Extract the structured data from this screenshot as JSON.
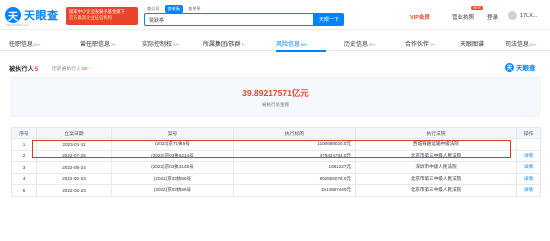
{
  "header": {
    "logo_mark": "天",
    "logo_text": "天眼查",
    "logo_sub": "TianYanCha.com",
    "promo_line1": "国家中小企业发展子基金旗下",
    "promo_line2": "官方备案企业征信机构",
    "search_tabs": [
      "查公司",
      "查老板",
      "查关系"
    ],
    "search_value": "贾跃亭",
    "search_button": "天眼一下",
    "vip": "VIP会员",
    "nav_items": [
      "营业执照",
      "登录"
    ],
    "new_badge": "NEW",
    "username": "17LX..."
  },
  "tabs": [
    {
      "label": "任职信息",
      "count": "99+"
    },
    {
      "label": "曾任职信息",
      "count": "26"
    },
    {
      "label": "实际控制权",
      "count": "99+"
    },
    {
      "label": "所属集团/族群",
      "count": "2"
    },
    {
      "label": "风险信息",
      "count": "99+"
    },
    {
      "label": "历史信息",
      "count": "99+"
    },
    {
      "label": "合作伙伴",
      "count": "19"
    },
    {
      "label": "天眼图谱",
      "count": ""
    },
    {
      "label": "司法信息",
      "count": "99+"
    }
  ],
  "section": {
    "title": "被执行人",
    "count": "5",
    "history_label": "历史被执行人",
    "history_count": "60",
    "logo_text": "天眼查"
  },
  "summary": {
    "amount": "39.89217571亿元",
    "label": "被执行总金额"
  },
  "table": {
    "headers": [
      "序号",
      "立案日期",
      "案号",
      "执行标的",
      "执行法院",
      "操作"
    ],
    "rows": [
      [
        "1",
        "2023-01-11",
        "(2023)京71执6号",
        "1100689020.0元",
        "西城铁路运输中级法院",
        ""
      ],
      [
        "2",
        "2022-07-25",
        "(2022)京03执6214号",
        "479334784.0元",
        "北京市第三中级人民法院",
        "详情"
      ],
      [
        "3",
        "2022-05-24",
        "(2022)京03执3148号",
        "1681227元",
        "深圳市中级人民法院",
        "详情"
      ],
      [
        "4",
        "2022-02-23",
        "(2022)京03执56号",
        "892555078.0元",
        "北京市第三中级人民法院",
        "详情"
      ],
      [
        "5",
        "2022-02-23",
        "(2022)京03执55号",
        "1514857440元",
        "北京市第三中级人民法院",
        "详情"
      ]
    ]
  }
}
